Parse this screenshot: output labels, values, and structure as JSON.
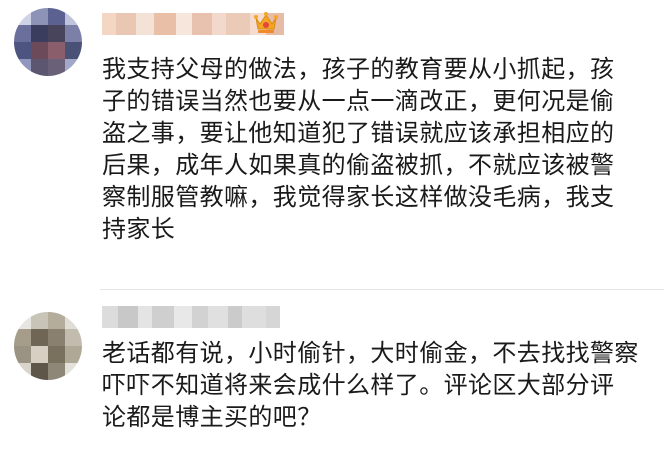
{
  "comments": [
    {
      "lines": [
        "我支持父母的做法，孩子的教育要从小抓起，孩",
        "子的错误当然也要从一点一滴改正，更何况是偷",
        "盗之事，要让他知道犯了错误就应该承担相应的",
        "后果，成年人如果真的偷盗被抓，不就应该被警",
        "察制服管教嘛，我觉得家长这样做没毛病，我支",
        "持家长"
      ],
      "badge_icon": "crown-icon"
    },
    {
      "lines": [
        "老话都有说，小时偷针，大时偷金，不去找找警察",
        "吓吓不知道将来会成什么样了。评论区大部分评",
        "论都是博主买的吧？"
      ]
    }
  ],
  "colors": {
    "text": "#1a1a1a",
    "crown": "#f5a623",
    "divider": "#e6e6e6"
  }
}
